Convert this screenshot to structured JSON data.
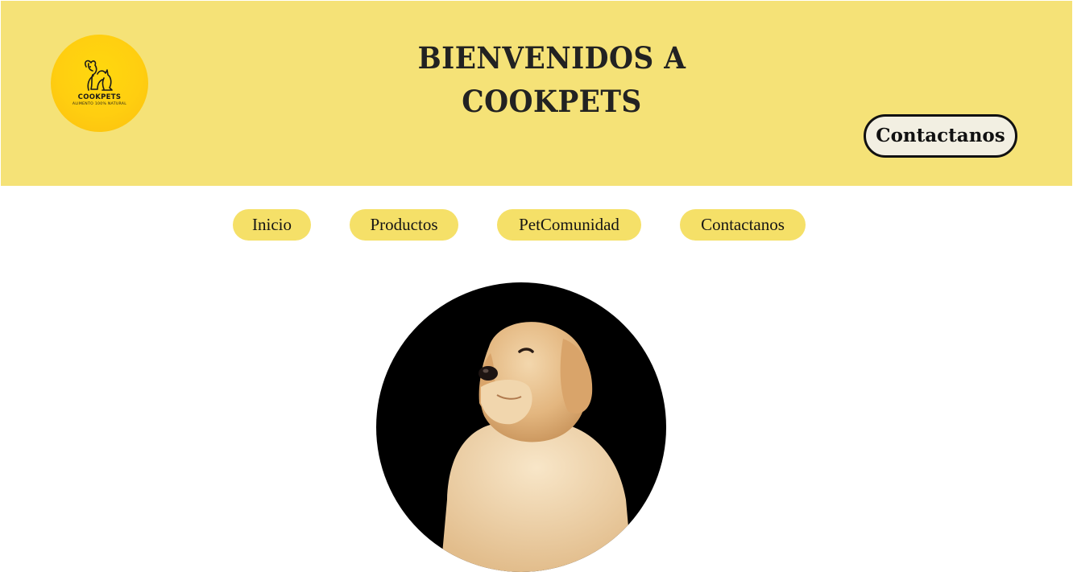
{
  "header": {
    "logo": {
      "name": "COOKPETS",
      "tagline": "ALIMENTO 100% NATURAL",
      "icon": "dog-cat-outline-icon"
    },
    "title_line1": "BIENVENIDOS A",
    "title_line2": "COOKPETS",
    "contact_button": "Contactanos"
  },
  "nav": {
    "items": [
      {
        "label": "Inicio"
      },
      {
        "label": "Productos"
      },
      {
        "label": "PetComunidad"
      },
      {
        "label": "Contactanos"
      }
    ]
  },
  "hero": {
    "image": "golden-retriever-puppy-photo"
  },
  "colors": {
    "header_bg": "#f5e277",
    "nav_pill": "#f5e068",
    "logo_yellow": "#ffd10f",
    "text_dark": "#222222",
    "contact_button_bg": "#f2efe2"
  }
}
